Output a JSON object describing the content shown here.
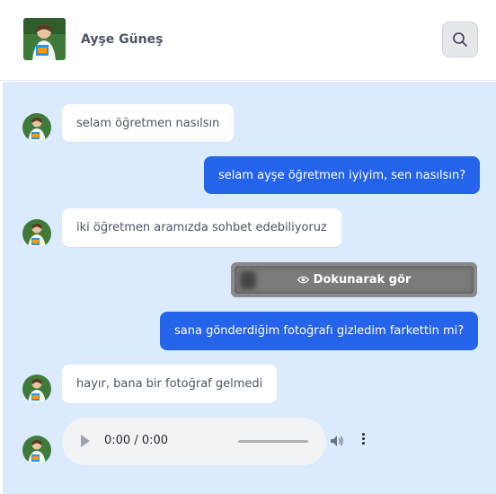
{
  "header": {
    "contact_name": "Ayşe Güneş",
    "search_icon": "search-icon"
  },
  "messages": [
    {
      "direction": "in",
      "text": "selam öğretmen nasılsın"
    },
    {
      "direction": "out",
      "text": "selam ayşe öğretmen iyiyim, sen nasılsın?"
    },
    {
      "direction": "in",
      "text": "iki öğretmen aramızda sohbet edebiliyoruz"
    },
    {
      "direction": "out",
      "type": "hidden-photo",
      "text": "Dokunarak gör",
      "icon": "eye-icon"
    },
    {
      "direction": "out",
      "text": "sana gönderdiğim fotoğrafı gizledim farkettin mi?"
    },
    {
      "direction": "in",
      "text": "hayır, bana bir fotoğraf gelmedi"
    },
    {
      "direction": "in",
      "type": "audio",
      "time": "0:00 / 0:00"
    }
  ],
  "colors": {
    "accent": "#2563eb",
    "chat_background": "#dbeafe",
    "incoming_bubble": "#ffffff"
  }
}
